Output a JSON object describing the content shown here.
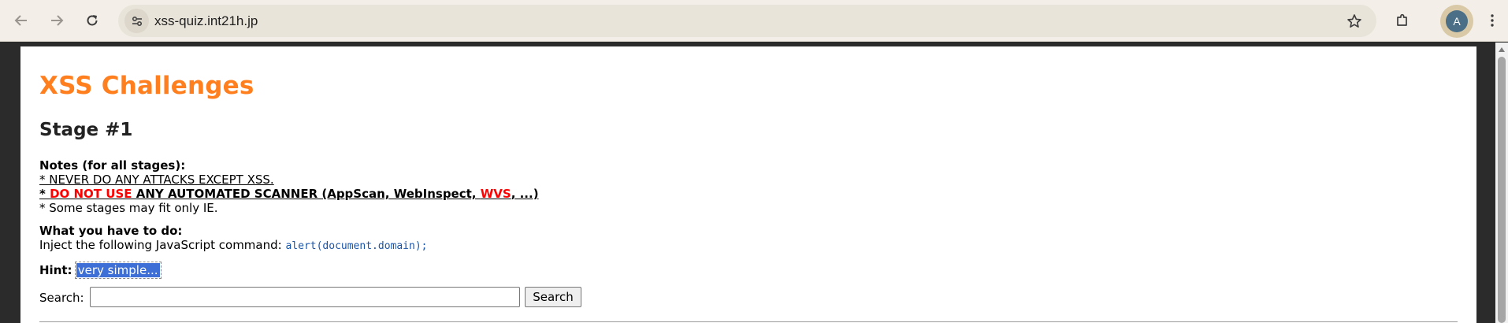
{
  "browser": {
    "url": "xss-quiz.int21h.jp",
    "profile_initial": "A",
    "icons": {
      "back": "back-arrow-icon",
      "forward": "forward-arrow-icon",
      "reload": "reload-icon",
      "site_info": "tune-icon",
      "bookmark": "star-icon",
      "extensions": "puzzle-icon",
      "menu": "kebab-menu-icon"
    }
  },
  "page": {
    "title": "XSS Challenges",
    "stage": "Stage #1",
    "notes": {
      "heading": "Notes (for all stages):",
      "line1": "* NEVER DO ANY ATTACKS EXCEPT XSS.",
      "line2_prefix": "* ",
      "line2_do_not_use": "DO NOT USE",
      "line2_mid": " ANY AUTOMATED SCANNER (AppScan, WebInspect, ",
      "line2_wvs": "WVS",
      "line2_suffix": ", ...)",
      "line3": "* Some stages may fit only IE."
    },
    "todo": {
      "heading": "What you have to do:",
      "text": "Inject the following JavaScript command: ",
      "code": "alert(document.domain);"
    },
    "hint": {
      "label": "Hint: ",
      "value": "very simple..."
    },
    "search": {
      "label": "Search: ",
      "value": "",
      "button": "Search"
    }
  },
  "colors": {
    "title": "#ff7f1e",
    "warning": "#ff0000",
    "code": "#1a55a8",
    "selection": "#3d6fd6"
  }
}
